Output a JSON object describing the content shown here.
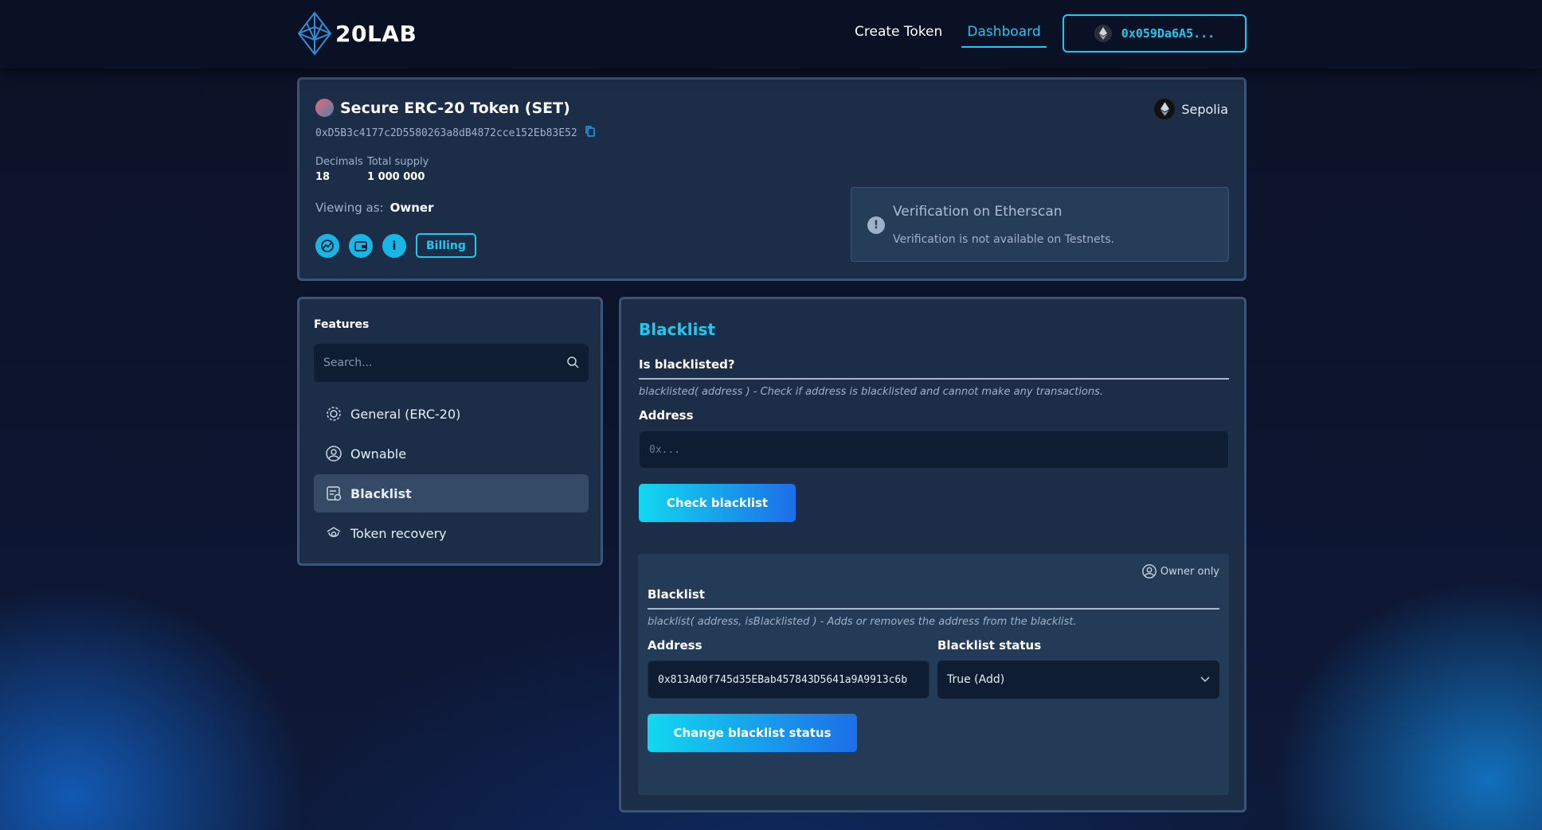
{
  "header": {
    "logo_text": "20LAB",
    "nav": {
      "create_token": "Create Token",
      "dashboard": "Dashboard"
    },
    "wallet_address": "0x059Da6A5..."
  },
  "token": {
    "name": "Secure ERC-20 Token (SET)",
    "address": "0xD5B3c4177c2D5580263a8dB4872cce152Eb83E52",
    "network": "Sepolia",
    "decimals_label": "Decimals",
    "decimals_value": "18",
    "supply_label": "Total supply",
    "supply_value": "1 000 000",
    "viewing_label": "Viewing as:",
    "viewing_value": "Owner",
    "billing_label": "Billing",
    "verification_title": "Verification on Etherscan",
    "verification_text": "Verification is not available on Testnets."
  },
  "features": {
    "title": "Features",
    "search_placeholder": "Search...",
    "items": [
      {
        "label": "General (ERC-20)",
        "icon": "gear-icon"
      },
      {
        "label": "Ownable",
        "icon": "user-circle-icon"
      },
      {
        "label": "Blacklist",
        "icon": "blacklist-icon"
      },
      {
        "label": "Token recovery",
        "icon": "recovery-icon"
      }
    ],
    "active_index": 2
  },
  "blacklist": {
    "title": "Blacklist",
    "check": {
      "heading": "Is blacklisted?",
      "description": "blacklisted( address ) - Check if address is blacklisted and cannot make any transactions.",
      "address_label": "Address",
      "address_placeholder": "0x...",
      "button": "Check blacklist"
    },
    "change": {
      "owner_only": "Owner only",
      "heading": "Blacklist",
      "description": "blacklist( address, isBlacklisted ) - Adds or removes the address from the blacklist.",
      "address_label": "Address",
      "address_value": "0x813Ad0f745d35EBab457843D5641a9A9913c6b",
      "status_label": "Blacklist status",
      "status_value": "True (Add)",
      "button": "Change blacklist status"
    }
  },
  "colors": {
    "accent": "#1ec8f0",
    "card": "#1c2e47",
    "card_border": "#3a5577",
    "background": "#0b1226"
  }
}
